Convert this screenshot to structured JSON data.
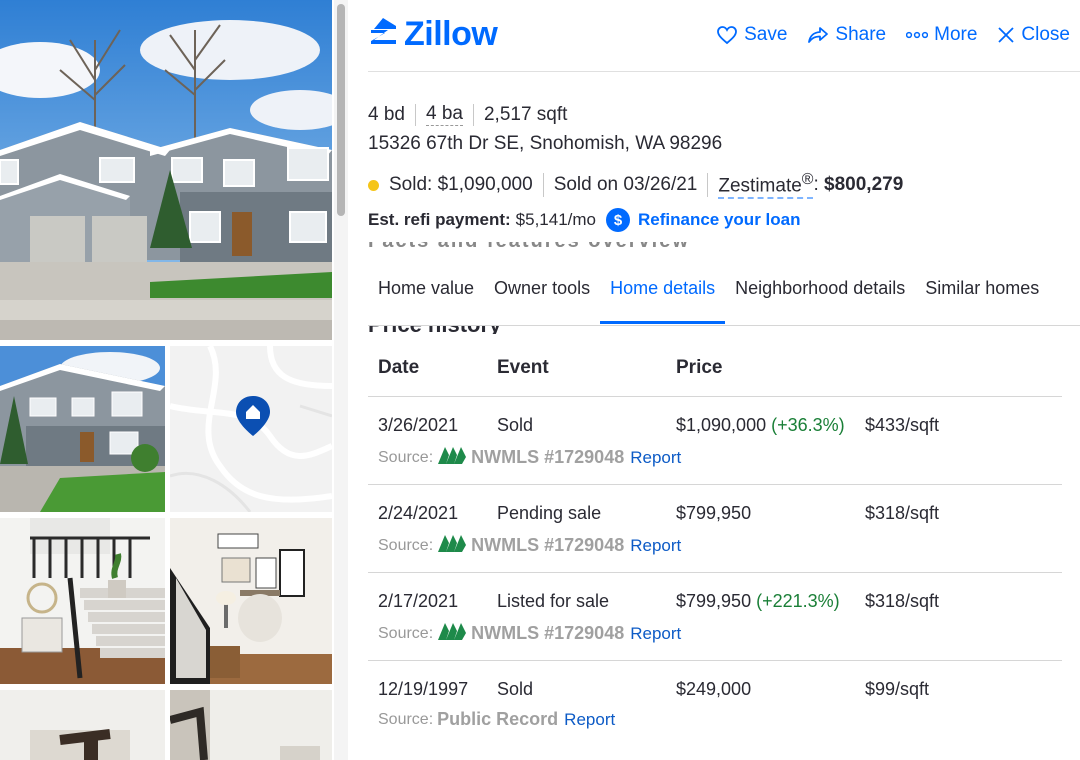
{
  "brand": {
    "name": "Zillow",
    "color": "#006aff"
  },
  "header_actions": [
    {
      "label": "Save",
      "icon": "heart-icon"
    },
    {
      "label": "Share",
      "icon": "share-icon"
    },
    {
      "label": "More",
      "icon": "more-icon"
    },
    {
      "label": "Close",
      "icon": "close-icon"
    }
  ],
  "facts": {
    "beds": "4 bd",
    "baths": "4 ba",
    "sqft": "2,517 sqft"
  },
  "address": "15326 67th Dr SE, Snohomish, WA 98296",
  "status": {
    "sold": "Sold: $1,090,000",
    "sold_on": "Sold on 03/26/21",
    "zestimate_label": "Zestimate",
    "zestimate_sup": "®",
    "zestimate_colon": ": ",
    "zestimate_value": "$800,279",
    "dot_color": "#f5c518"
  },
  "refi": {
    "label": "Est. refi payment:",
    "value": "$5,141/mo",
    "badge": "$",
    "link": "Refinance your loan"
  },
  "cut_text": "Facts and features overview",
  "tabs": [
    {
      "label": "Home value",
      "active": false
    },
    {
      "label": "Owner tools",
      "active": false
    },
    {
      "label": "Home details",
      "active": true
    },
    {
      "label": "Neighborhood details",
      "active": false
    },
    {
      "label": "Similar homes",
      "active": false
    }
  ],
  "price_history": {
    "title": "Price history",
    "headers": {
      "date": "Date",
      "event": "Event",
      "price": "Price"
    },
    "rows": [
      {
        "date": "3/26/2021",
        "event": "Sold",
        "price": "$1,090,000",
        "change": "(+36.3%)",
        "per_sqft": "$433/sqft",
        "source_label": "Source:",
        "source": "NWMLS #1729048",
        "report": "Report",
        "mls_logo": true
      },
      {
        "date": "2/24/2021",
        "event": "Pending sale",
        "price": "$799,950",
        "change": "",
        "per_sqft": "$318/sqft",
        "source_label": "Source:",
        "source": "NWMLS #1729048",
        "report": "Report",
        "mls_logo": true
      },
      {
        "date": "2/17/2021",
        "event": "Listed for sale",
        "price": "$799,950",
        "change": "(+221.3%)",
        "per_sqft": "$318/sqft",
        "source_label": "Source:",
        "source": "NWMLS #1729048",
        "report": "Report",
        "mls_logo": true
      },
      {
        "date": "12/19/1997",
        "event": "Sold",
        "price": "$249,000",
        "change": "",
        "per_sqft": "$99/sqft",
        "source_label": "Source:",
        "source": "Public Record",
        "report": "Report",
        "mls_logo": false
      }
    ]
  },
  "colors": {
    "accent": "#006aff",
    "positive": "#1a7f37",
    "muted": "#999999"
  }
}
